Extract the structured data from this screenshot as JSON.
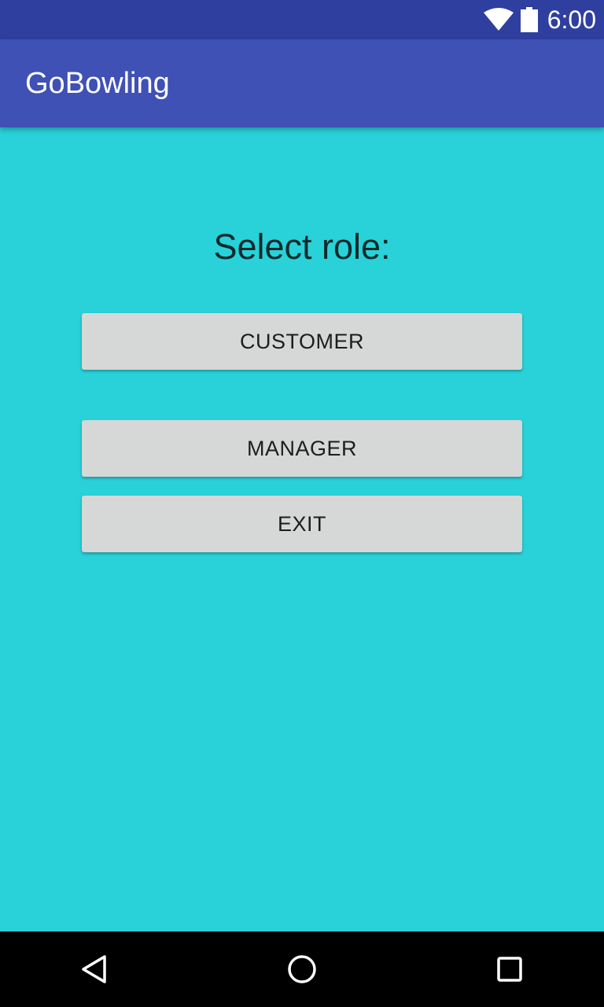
{
  "status_bar": {
    "time": "6:00",
    "icons": [
      "wifi-icon",
      "battery-icon"
    ]
  },
  "app_bar": {
    "title": "GoBowling"
  },
  "main": {
    "prompt": "Select role:",
    "buttons": {
      "customer": "CUSTOMER",
      "manager": "MANAGER",
      "exit": "EXIT"
    }
  },
  "nav_bar": {
    "icons": [
      "back-icon",
      "home-icon",
      "recents-icon"
    ]
  },
  "colors": {
    "status_bar": "#2f3f9f",
    "app_bar": "#3f51b5",
    "background": "#29d1d8",
    "button": "#d6d7d7",
    "nav_bar": "#000000"
  }
}
